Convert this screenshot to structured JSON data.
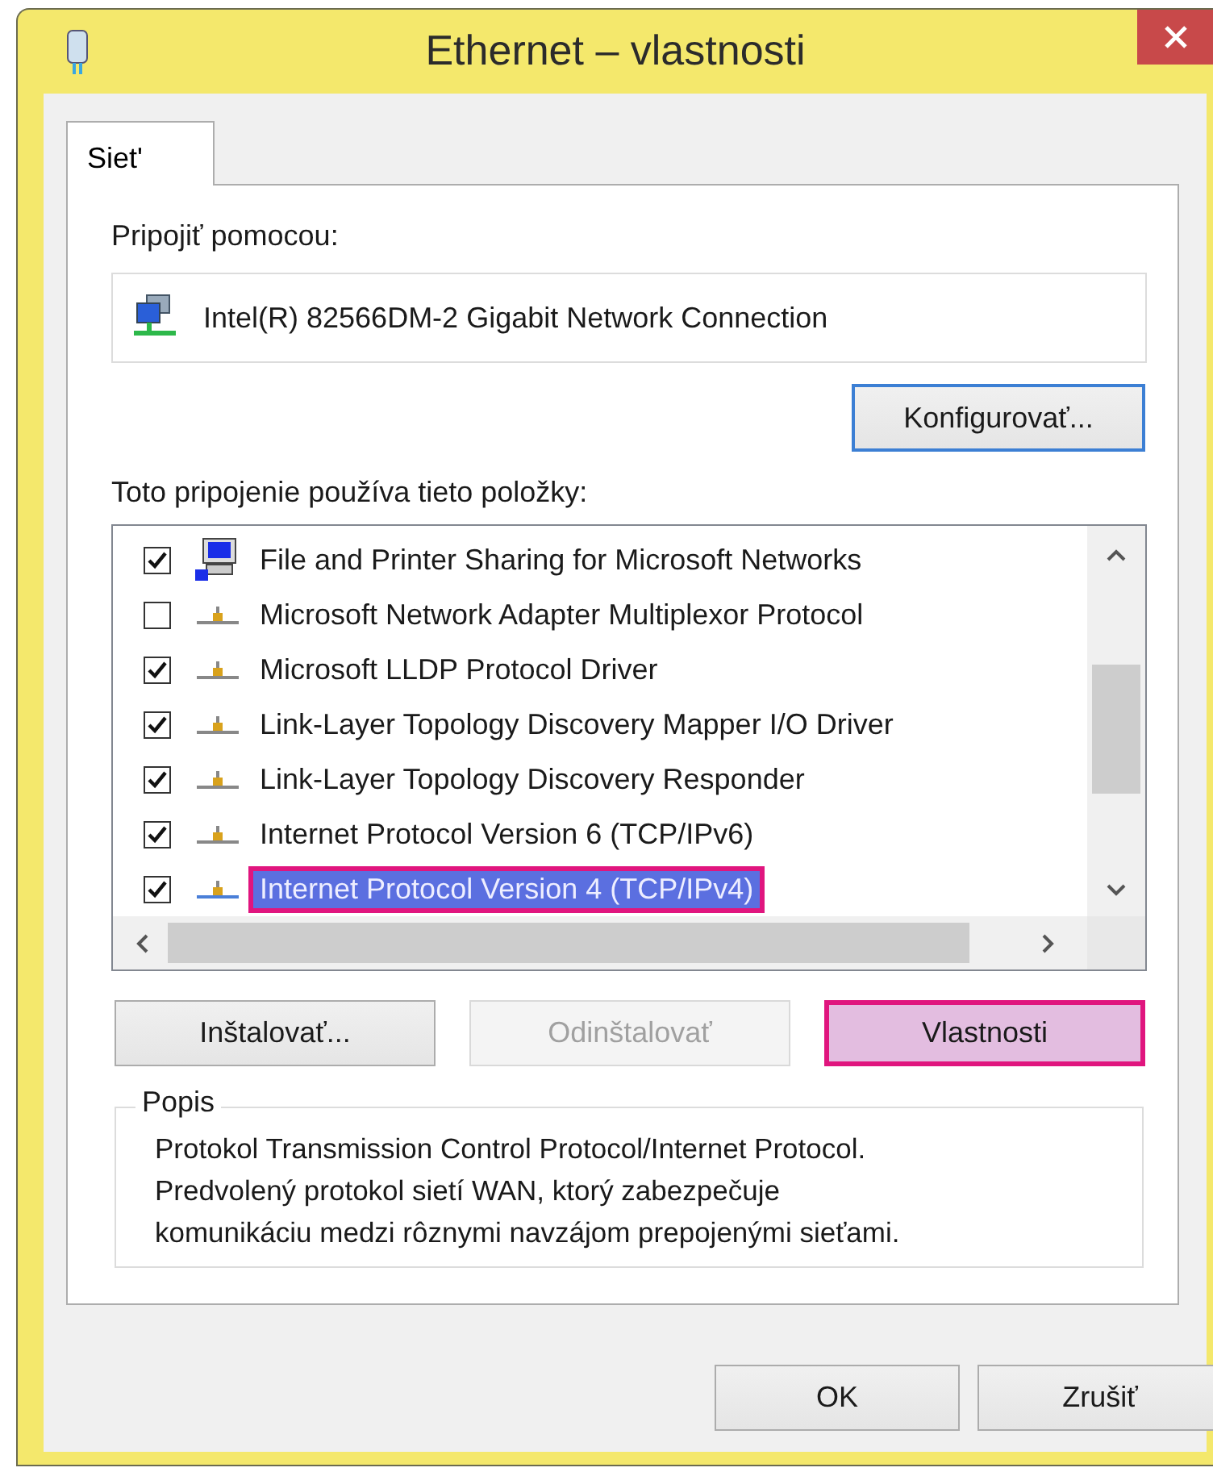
{
  "window": {
    "title": "Ethernet – vlastnosti"
  },
  "tabs": [
    {
      "label": "Siet'",
      "selected": true
    }
  ],
  "connect_using": {
    "label": "Pripojiť pomocou:",
    "adapter": "Intel(R) 82566DM-2 Gigabit Network Connection",
    "button": {
      "label": "Konfigurovať...",
      "focused": true
    }
  },
  "items": {
    "label": "Toto pripojenie používa tieto položky:",
    "rows": [
      {
        "kind": "service",
        "label": "File and Printer Sharing for Microsoft Networks",
        "checked": true,
        "selected": false
      },
      {
        "kind": "protocol",
        "label": "Microsoft Network Adapter Multiplexor Protocol",
        "checked": false,
        "selected": false
      },
      {
        "kind": "protocol",
        "label": "Microsoft LLDP Protocol Driver",
        "checked": true,
        "selected": false
      },
      {
        "kind": "protocol",
        "label": "Link-Layer Topology Discovery Mapper I/O Driver",
        "checked": true,
        "selected": false
      },
      {
        "kind": "protocol",
        "label": "Link-Layer Topology Discovery Responder",
        "checked": true,
        "selected": false
      },
      {
        "kind": "protocol",
        "label": "Internet Protocol Version 6 (TCP/IPv6)",
        "checked": true,
        "selected": false
      },
      {
        "kind": "protocol",
        "label": "Internet Protocol Version 4 (TCP/IPv4)",
        "checked": true,
        "selected": true
      }
    ]
  },
  "item_buttons": [
    {
      "label": "Inštalovať...",
      "disabled": false,
      "highlighted": false
    },
    {
      "label": "Odinštalovať",
      "disabled": true,
      "highlighted": false
    },
    {
      "label": "Vlastnosti",
      "disabled": false,
      "highlighted": true
    }
  ],
  "description": {
    "title": "Popis",
    "text": "Protokol Transmission Control Protocol/Internet Protocol.\nPredvolený protokol sietí WAN, ktorý zabezpečuje\nkomunikáciu medzi rôznymi navzájom prepojenými sieťami."
  },
  "buttons": [
    {
      "label": "OK"
    },
    {
      "label": "Zrušiť"
    }
  ]
}
